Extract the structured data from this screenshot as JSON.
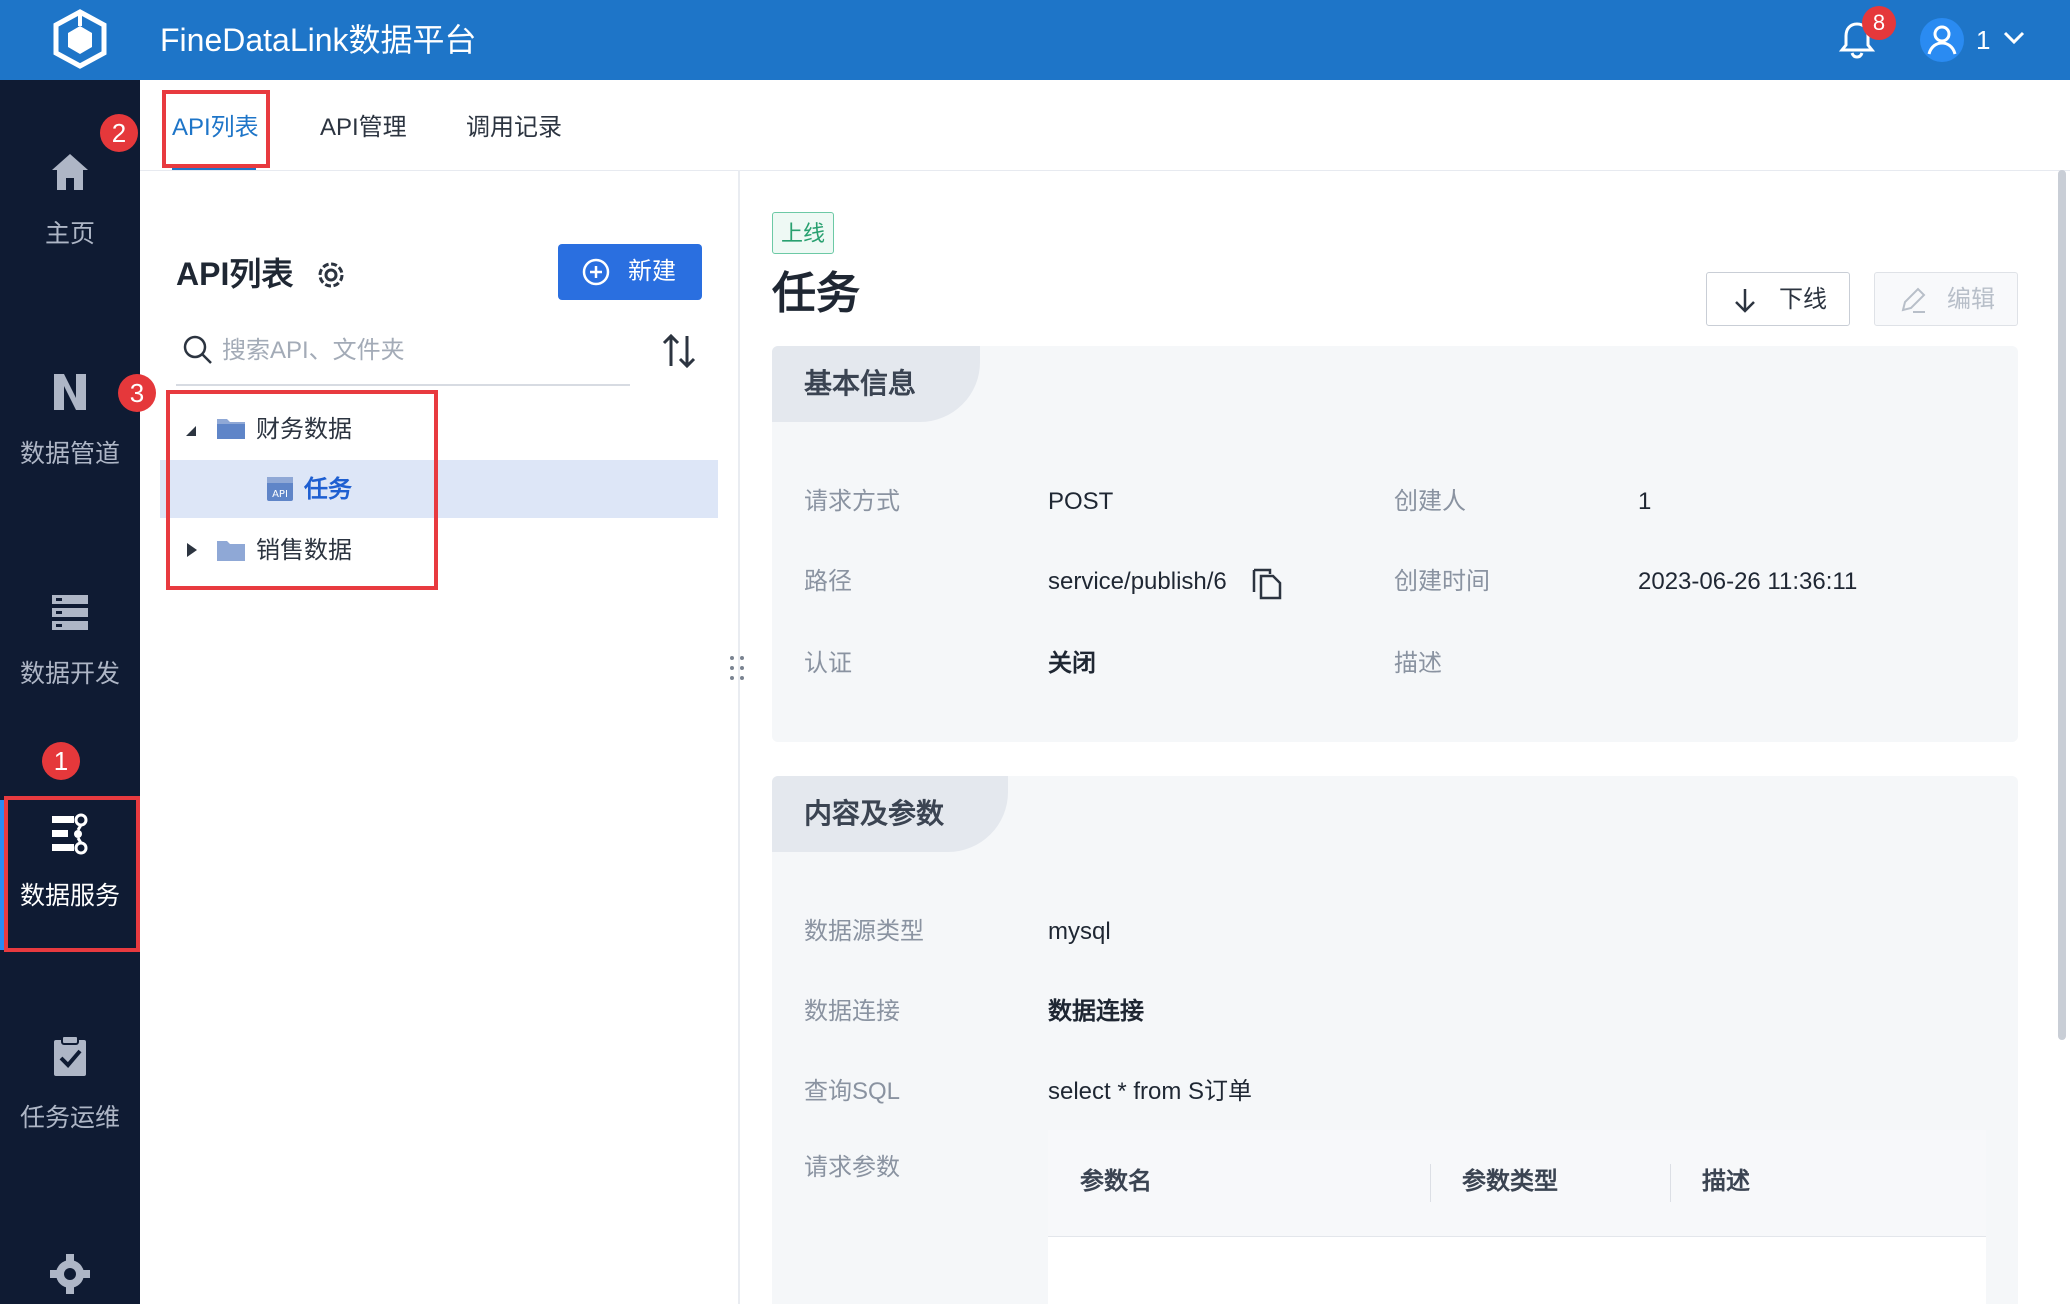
{
  "header": {
    "app_title": "FineDataLink数据平台",
    "notification_count": "8",
    "user_name": "1",
    "brand_color": "#1e75c8"
  },
  "sidenav": {
    "items": [
      {
        "label": "主页",
        "icon": "home-icon"
      },
      {
        "label": "数据管道",
        "icon": "pipeline-icon"
      },
      {
        "label": "数据开发",
        "icon": "dev-icon"
      },
      {
        "label": "数据服务",
        "icon": "service-icon",
        "active": true
      },
      {
        "label": "任务运维",
        "icon": "clipboard-check-icon"
      },
      {
        "label": "",
        "icon": "gear-icon"
      }
    ]
  },
  "tabs": [
    {
      "label": "API列表",
      "active": true
    },
    {
      "label": "API管理"
    },
    {
      "label": "调用记录"
    }
  ],
  "left_panel": {
    "title": "API列表",
    "new_button": "新建",
    "search_placeholder": "搜索API、文件夹",
    "tree": [
      {
        "label": "财务数据",
        "type": "folder",
        "expanded": true
      },
      {
        "label": "任务",
        "type": "api",
        "badge": "API",
        "selected": true
      },
      {
        "label": "销售数据",
        "type": "folder",
        "expanded": false
      }
    ]
  },
  "annotations": [
    "1",
    "2",
    "3"
  ],
  "detail": {
    "status": "上线",
    "title": "任务",
    "offline_button": "下线",
    "edit_button": "编辑",
    "basic": {
      "heading": "基本信息",
      "method_label": "请求方式",
      "method_value": "POST",
      "creator_label": "创建人",
      "creator_value": "1",
      "path_label": "路径",
      "path_value": "service/publish/6",
      "created_label": "创建时间",
      "created_value": "2023-06-26 11:36:11",
      "auth_label": "认证",
      "auth_value": "关闭",
      "desc_label": "描述"
    },
    "content": {
      "heading": "内容及参数",
      "source_type_label": "数据源类型",
      "source_type_value": "mysql",
      "connection_label": "数据连接",
      "connection_value": "数据连接",
      "sql_label": "查询SQL",
      "sql_value": "select * from S订单",
      "params_label": "请求参数",
      "columns": [
        "参数名",
        "参数类型",
        "描述"
      ]
    }
  }
}
